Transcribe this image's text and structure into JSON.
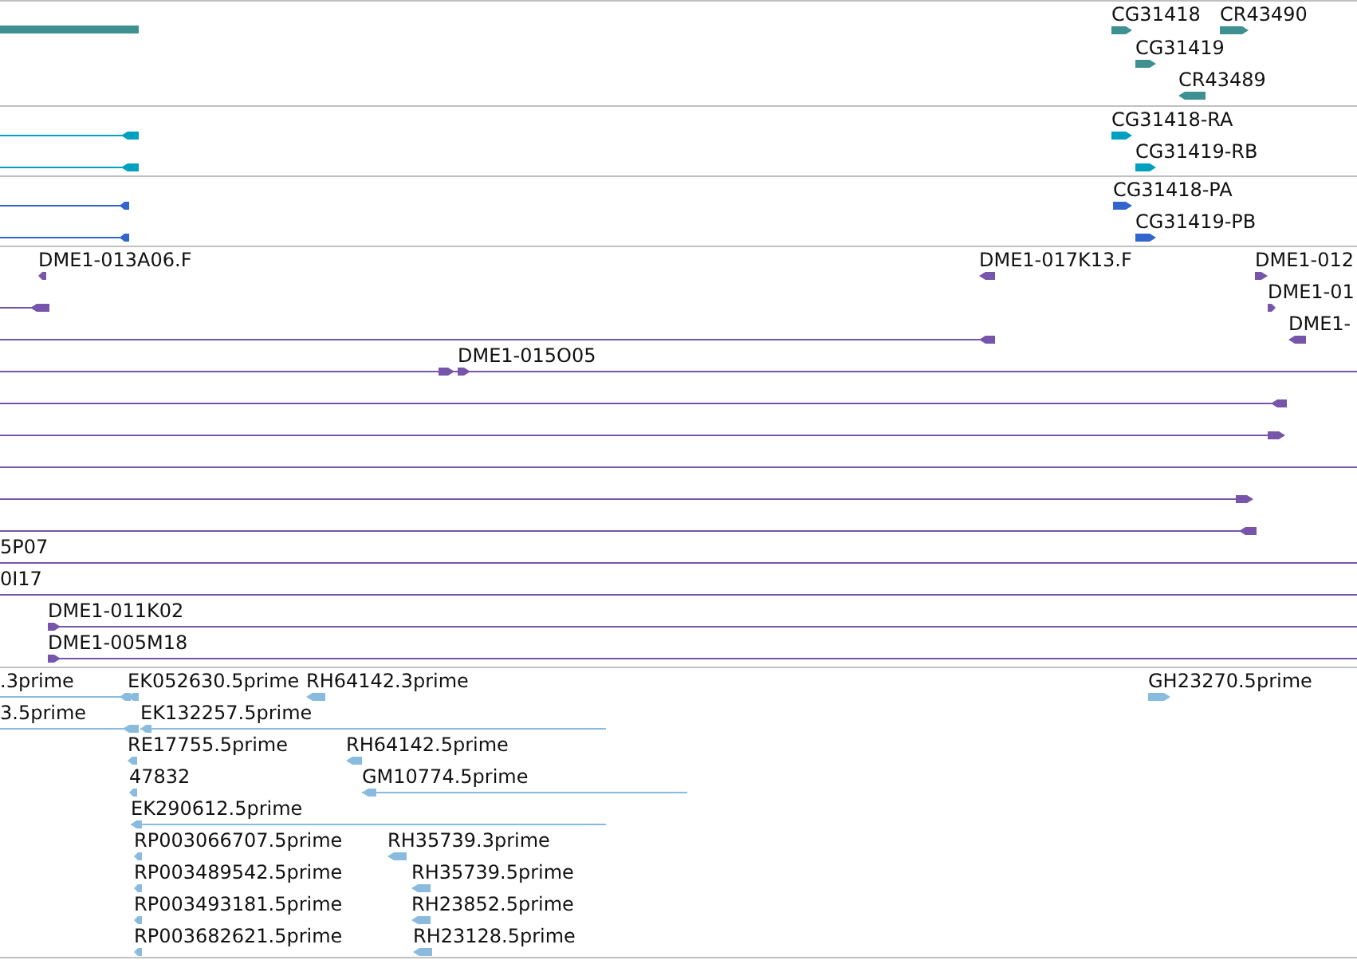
{
  "tracks": [
    {
      "kind": "gene",
      "features": [
        {
          "kind": "bar"
        },
        {
          "kind": "arrow",
          "label": "CG31418",
          "reverse": false
        },
        {
          "kind": "arrow",
          "label": "CR43490",
          "reverse": false
        },
        {
          "kind": "arrow",
          "label": "CG31419",
          "reverse": false
        },
        {
          "kind": "arrow",
          "label": "CR43489",
          "reverse": true
        }
      ]
    },
    {
      "kind": "transcript",
      "features": [
        {
          "kind": "arrow",
          "reverse": true
        },
        {
          "kind": "arrow",
          "reverse": true
        },
        {
          "kind": "arrow",
          "label": "CG31418-RA",
          "reverse": false
        },
        {
          "kind": "arrow",
          "label": "CG31419-RB",
          "reverse": false
        }
      ]
    },
    {
      "kind": "protein",
      "features": [
        {
          "kind": "arrow",
          "reverse": true
        },
        {
          "kind": "arrow",
          "reverse": true
        },
        {
          "kind": "arrow",
          "label": "CG31418-PA",
          "reverse": false
        },
        {
          "kind": "arrow",
          "label": "CG31419-PB",
          "reverse": false
        }
      ]
    },
    {
      "kind": "clone",
      "features": [
        {
          "kind": "arrow",
          "label": "DME1-013A06.F",
          "reverse": true
        },
        {
          "kind": "arrow",
          "label": "DME1-017K13.F",
          "reverse": true
        },
        {
          "kind": "arrow",
          "label": "DME1-012",
          "reverse": false
        },
        {
          "kind": "arrow",
          "reverse": true
        },
        {
          "kind": "arrow",
          "label": "DME1-01",
          "reverse": false
        },
        {
          "kind": "arrow",
          "reverse": true
        },
        {
          "kind": "arrow",
          "label": "DME1-",
          "reverse": true
        },
        {
          "kind": "arrow",
          "reverse": false
        },
        {
          "kind": "arrow",
          "label": "DME1-015O05",
          "reverse": false
        },
        {
          "kind": "arrow",
          "reverse": true
        },
        {
          "kind": "arrow",
          "reverse": false
        },
        {
          "kind": "line"
        },
        {
          "kind": "arrow",
          "reverse": false
        },
        {
          "kind": "arrow",
          "reverse": true
        },
        {
          "kind": "line",
          "label": "5P07"
        },
        {
          "kind": "line",
          "label": "0I17"
        },
        {
          "kind": "arrow",
          "label": "DME1-011K02",
          "reverse": false
        },
        {
          "kind": "arrow",
          "label": "DME1-005M18",
          "reverse": false
        }
      ]
    },
    {
      "kind": "est",
      "features": [
        {
          "kind": "arrow",
          "label": ".3prime",
          "reverse": true
        },
        {
          "kind": "arrow",
          "label": "EK052630.5prime",
          "reverse": true
        },
        {
          "kind": "arrow",
          "label": "RH64142.3prime",
          "reverse": true
        },
        {
          "kind": "arrow",
          "label": "GH23270.5prime",
          "reverse": false
        },
        {
          "kind": "arrow",
          "label": "3.5prime",
          "reverse": true
        },
        {
          "kind": "arrow",
          "label": "EK132257.5prime",
          "reverse": true
        },
        {
          "kind": "arrow",
          "label": "RE17755.5prime",
          "reverse": true
        },
        {
          "kind": "arrow",
          "label": "RH64142.5prime",
          "reverse": true
        },
        {
          "kind": "arrow",
          "label": "47832",
          "reverse": true
        },
        {
          "kind": "arrow",
          "label": "GM10774.5prime",
          "reverse": true
        },
        {
          "kind": "arrow",
          "label": "EK290612.5prime",
          "reverse": true
        },
        {
          "kind": "arrow",
          "label": "RP003066707.5prime",
          "reverse": true
        },
        {
          "kind": "arrow",
          "label": "RH35739.3prime",
          "reverse": true
        },
        {
          "kind": "arrow",
          "label": "RP003489542.5prime",
          "reverse": true
        },
        {
          "kind": "arrow",
          "label": "RH35739.5prime",
          "reverse": true
        },
        {
          "kind": "arrow",
          "label": "RP003493181.5prime",
          "reverse": true
        },
        {
          "kind": "arrow",
          "label": "RH23852.5prime",
          "reverse": true
        },
        {
          "kind": "arrow",
          "label": "RP003682621.5prime",
          "reverse": true
        },
        {
          "kind": "arrow",
          "label": "RH23128.5prime",
          "reverse": true
        }
      ]
    }
  ]
}
